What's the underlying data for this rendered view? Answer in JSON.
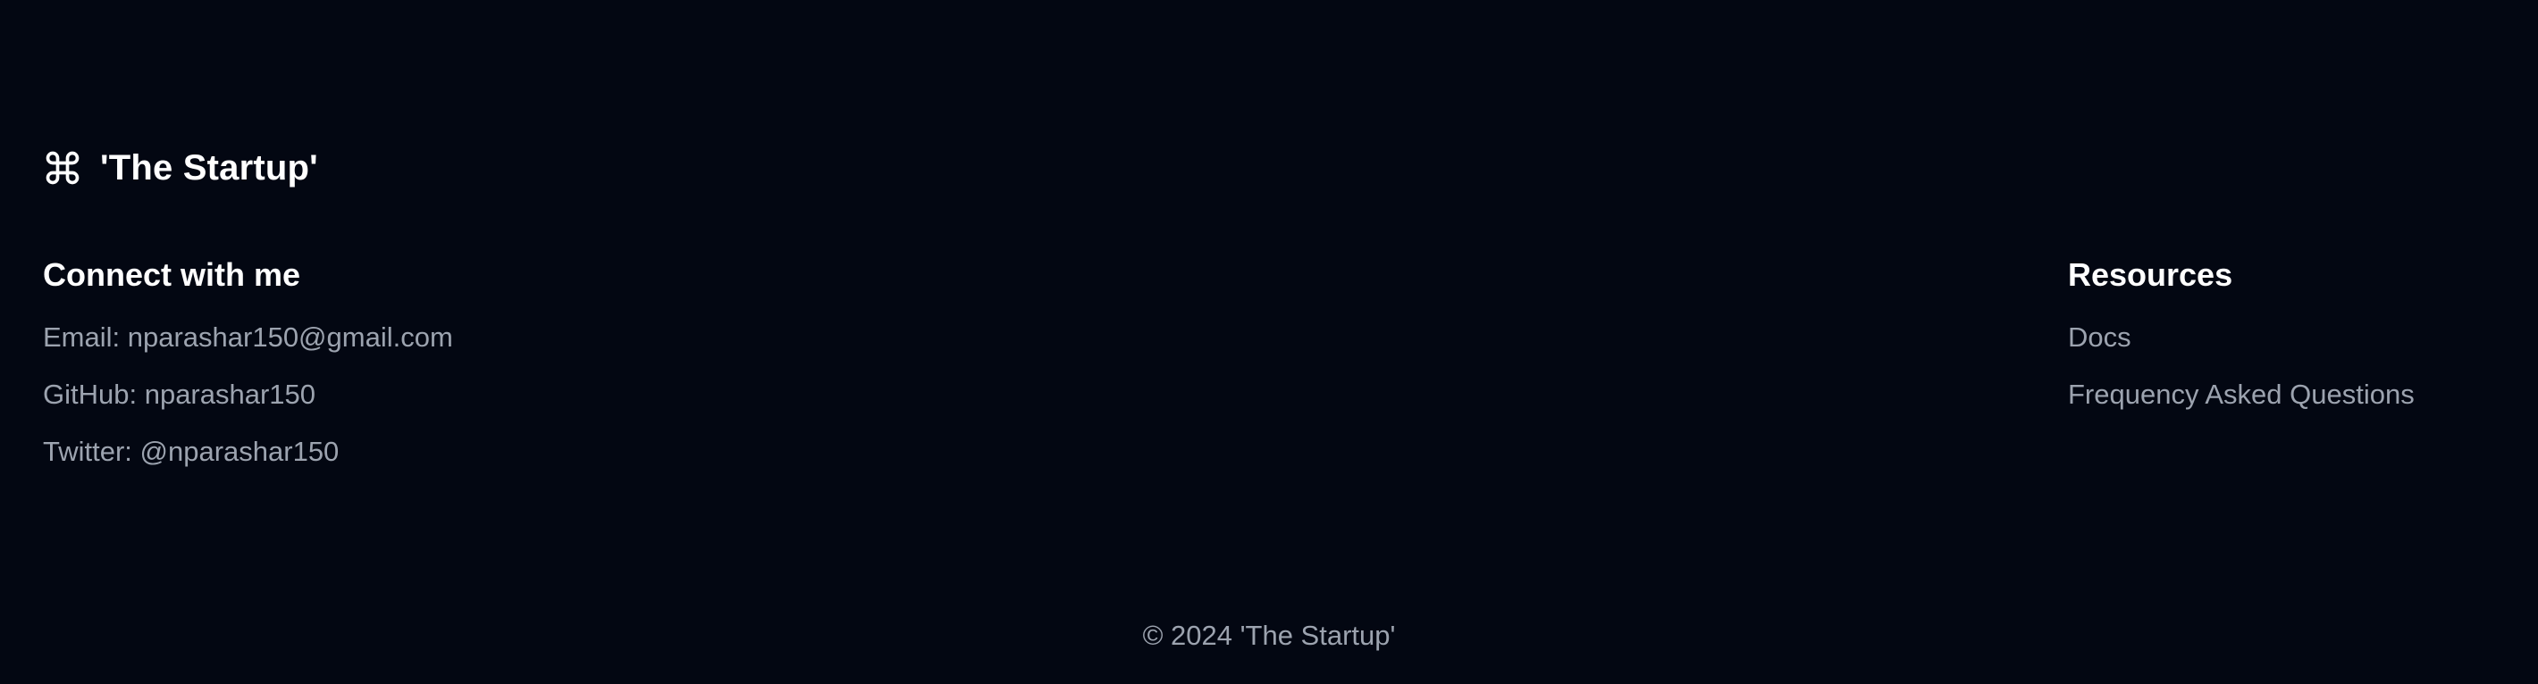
{
  "brand": {
    "icon": "command-icon",
    "name": "'The Startup'"
  },
  "connect": {
    "title": "Connect with me",
    "items": [
      "Email: nparashar150@gmail.com",
      "GitHub: nparashar150",
      "Twitter: @nparashar150"
    ]
  },
  "resources": {
    "title": "Resources",
    "items": [
      "Docs",
      "Frequency Asked Questions"
    ]
  },
  "copyright": "© 2024 'The Startup'",
  "colors": {
    "background": "#030712",
    "heading": "#ffffff",
    "muted": "#9ca3af"
  }
}
